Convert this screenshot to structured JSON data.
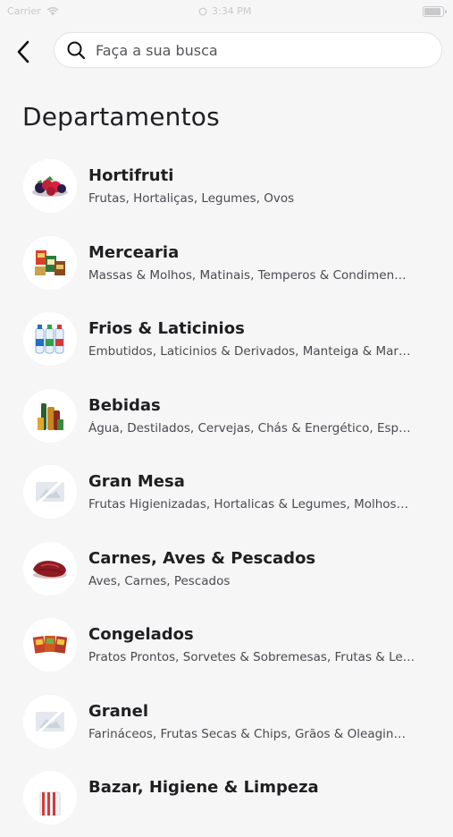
{
  "status_bar": {
    "carrier": "Carrier",
    "time": "3:34 PM"
  },
  "header": {
    "back_icon": "chevron-left-icon",
    "search": {
      "placeholder": "Faça a sua busca",
      "value": "",
      "icon": "search-icon"
    }
  },
  "page": {
    "title": "Departamentos"
  },
  "departments": [
    {
      "name": "Hortifruti",
      "subcategories": "Frutas, Hortaliças, Legumes, Ovos",
      "icon": "berries-image"
    },
    {
      "name": "Mercearia",
      "subcategories": "Massas & Molhos, Matinais, Temperos & Condimen…",
      "icon": "groceries-image"
    },
    {
      "name": "Frios & Laticinios",
      "subcategories": "Embutidos, Laticinios & Derivados, Manteiga & Mar…",
      "icon": "milk-bottles-image"
    },
    {
      "name": "Bebidas",
      "subcategories": "Água, Destilados, Cervejas, Chás & Energético, Esp…",
      "icon": "drinks-image"
    },
    {
      "name": "Gran Mesa",
      "subcategories": "Frutas Higienizadas, Hortalicas & Legumes, Molhos…",
      "icon": "image-placeholder-icon"
    },
    {
      "name": "Carnes, Aves & Pescados",
      "subcategories": "Aves, Carnes, Pescados",
      "icon": "meat-image"
    },
    {
      "name": "Congelados",
      "subcategories": "Pratos Prontos, Sorvetes & Sobremesas, Frutas & Le…",
      "icon": "frozen-food-image"
    },
    {
      "name": "Granel",
      "subcategories": "Farináceos, Frutas Secas & Chips, Grãos & Oleagin…",
      "icon": "image-placeholder-icon"
    },
    {
      "name": "Bazar, Higiene & Limpeza",
      "subcategories": "",
      "icon": "bazaar-image"
    }
  ]
}
